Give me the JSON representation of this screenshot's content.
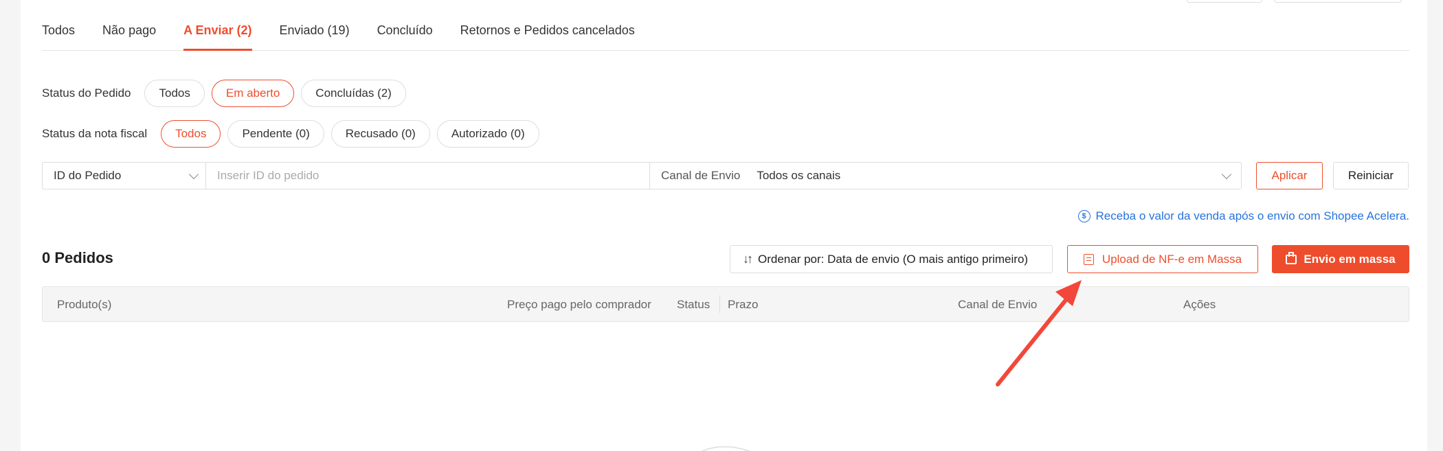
{
  "tabs": [
    {
      "label": "Todos"
    },
    {
      "label": "Não pago"
    },
    {
      "label": "A Enviar (2)"
    },
    {
      "label": "Enviado (19)"
    },
    {
      "label": "Concluído"
    },
    {
      "label": "Retornos e Pedidos cancelados"
    }
  ],
  "order_status": {
    "label": "Status do Pedido",
    "options": [
      "Todos",
      "Em aberto",
      "Concluídas (2)"
    ],
    "selected": "Em aberto"
  },
  "invoice_status": {
    "label": "Status da nota fiscal",
    "options": [
      "Todos",
      "Pendente (0)",
      "Recusado (0)",
      "Autorizado (0)"
    ],
    "selected": "Todos"
  },
  "search": {
    "field_select": "ID do Pedido",
    "placeholder": "Inserir ID do pedido",
    "value": ""
  },
  "channel": {
    "label": "Canal de Envio",
    "value": "Todos os canais"
  },
  "buttons": {
    "apply": "Aplicar",
    "reset": "Reiniciar",
    "sort": "Ordenar por: Data de envio (O mais antigo primeiro)",
    "upload": "Upload de NF-e em Massa",
    "mass_ship": "Envio em massa"
  },
  "promo": {
    "text": "Receba o valor da venda após o envio com Shopee Acelera.",
    "icon": "dollar-coin-icon"
  },
  "orders": {
    "count_label": "0 Pedidos"
  },
  "table": {
    "columns": [
      "Produto(s)",
      "Preço pago pelo comprador",
      "Status",
      "Prazo",
      "Canal de Envio",
      "Ações"
    ]
  },
  "colors": {
    "accent": "#ee4d2d",
    "link": "#2673dd",
    "arrow": "#f2473a"
  },
  "icons": [
    "chevron-down-icon",
    "sort-icon",
    "document-list-icon",
    "printer-icon",
    "dollar-coin-icon",
    "red-arrow-annotation"
  ]
}
